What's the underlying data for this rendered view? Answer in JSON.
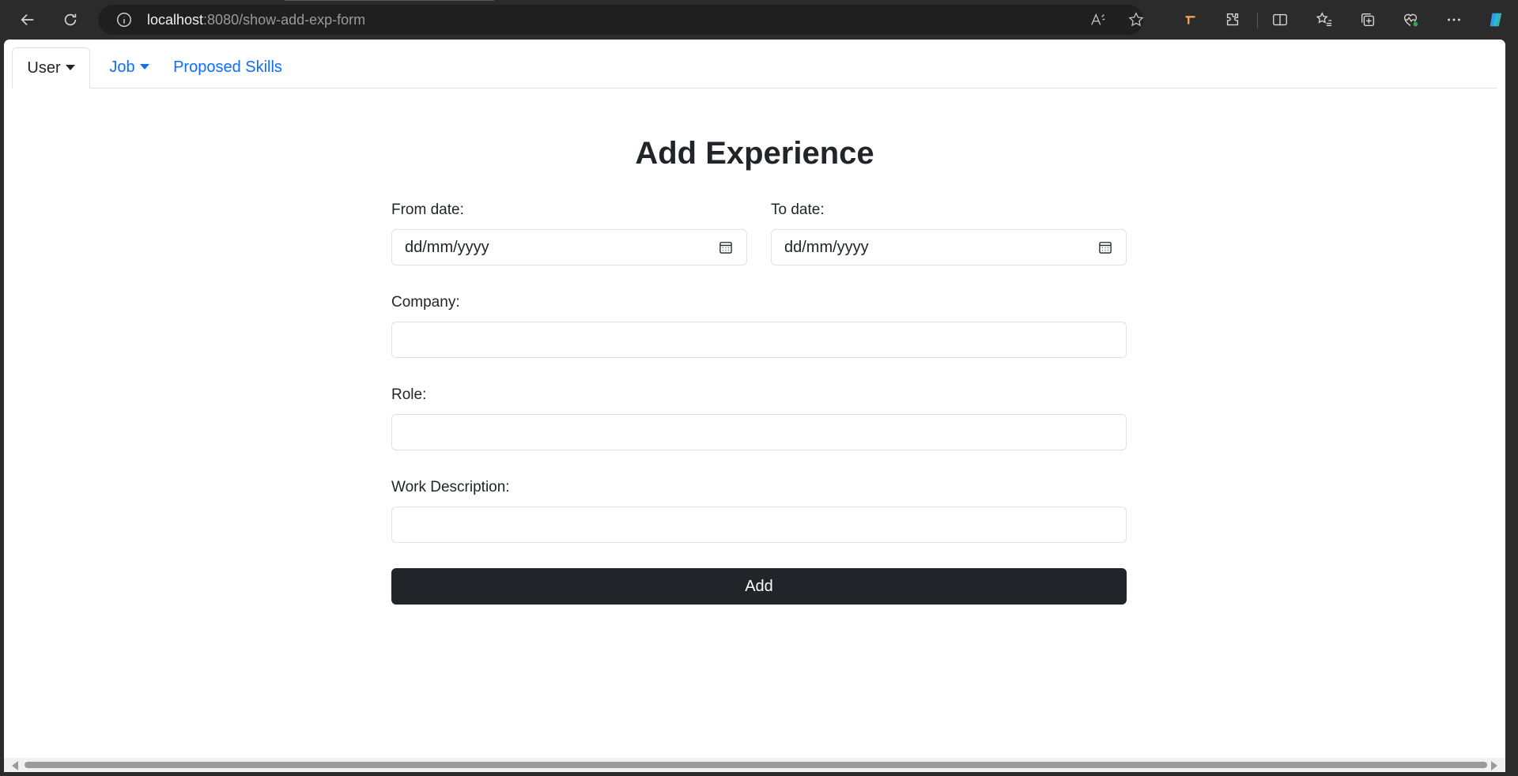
{
  "browser": {
    "url_host": "localhost",
    "url_path": ":8080/show-add-exp-form"
  },
  "nav": {
    "tabs": [
      {
        "label": "User",
        "dropdown": true,
        "active": true
      },
      {
        "label": "Job",
        "dropdown": true,
        "active": false
      },
      {
        "label": "Proposed Skills",
        "dropdown": false,
        "active": false
      }
    ]
  },
  "form": {
    "title": "Add Experience",
    "from_date": {
      "label": "From date:",
      "placeholder": "dd/mm/yyyy"
    },
    "to_date": {
      "label": "To date:",
      "placeholder": "dd/mm/yyyy"
    },
    "company": {
      "label": "Company:",
      "value": ""
    },
    "role": {
      "label": "Role:",
      "value": ""
    },
    "work_description": {
      "label": "Work Description:",
      "value": ""
    },
    "submit_label": "Add"
  },
  "colors": {
    "link": "#0d6efd",
    "button_bg": "#212529",
    "border": "#dee2e6"
  }
}
